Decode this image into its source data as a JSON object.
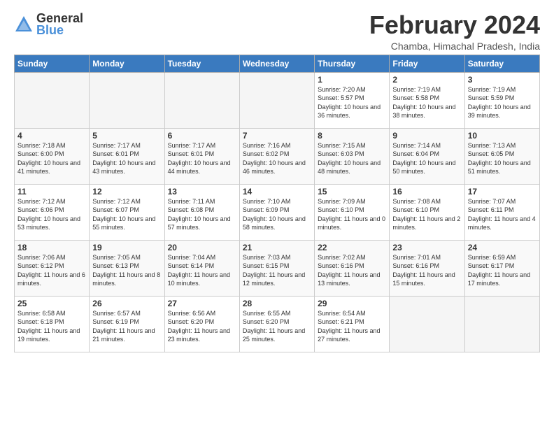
{
  "logo": {
    "general": "General",
    "blue": "Blue"
  },
  "title": "February 2024",
  "location": "Chamba, Himachal Pradesh, India",
  "headers": [
    "Sunday",
    "Monday",
    "Tuesday",
    "Wednesday",
    "Thursday",
    "Friday",
    "Saturday"
  ],
  "weeks": [
    [
      {
        "day": "",
        "sunrise": "",
        "sunset": "",
        "daylight": ""
      },
      {
        "day": "",
        "sunrise": "",
        "sunset": "",
        "daylight": ""
      },
      {
        "day": "",
        "sunrise": "",
        "sunset": "",
        "daylight": ""
      },
      {
        "day": "",
        "sunrise": "",
        "sunset": "",
        "daylight": ""
      },
      {
        "day": "1",
        "sunrise": "Sunrise: 7:20 AM",
        "sunset": "Sunset: 5:57 PM",
        "daylight": "Daylight: 10 hours and 36 minutes."
      },
      {
        "day": "2",
        "sunrise": "Sunrise: 7:19 AM",
        "sunset": "Sunset: 5:58 PM",
        "daylight": "Daylight: 10 hours and 38 minutes."
      },
      {
        "day": "3",
        "sunrise": "Sunrise: 7:19 AM",
        "sunset": "Sunset: 5:59 PM",
        "daylight": "Daylight: 10 hours and 39 minutes."
      }
    ],
    [
      {
        "day": "4",
        "sunrise": "Sunrise: 7:18 AM",
        "sunset": "Sunset: 6:00 PM",
        "daylight": "Daylight: 10 hours and 41 minutes."
      },
      {
        "day": "5",
        "sunrise": "Sunrise: 7:17 AM",
        "sunset": "Sunset: 6:01 PM",
        "daylight": "Daylight: 10 hours and 43 minutes."
      },
      {
        "day": "6",
        "sunrise": "Sunrise: 7:17 AM",
        "sunset": "Sunset: 6:01 PM",
        "daylight": "Daylight: 10 hours and 44 minutes."
      },
      {
        "day": "7",
        "sunrise": "Sunrise: 7:16 AM",
        "sunset": "Sunset: 6:02 PM",
        "daylight": "Daylight: 10 hours and 46 minutes."
      },
      {
        "day": "8",
        "sunrise": "Sunrise: 7:15 AM",
        "sunset": "Sunset: 6:03 PM",
        "daylight": "Daylight: 10 hours and 48 minutes."
      },
      {
        "day": "9",
        "sunrise": "Sunrise: 7:14 AM",
        "sunset": "Sunset: 6:04 PM",
        "daylight": "Daylight: 10 hours and 50 minutes."
      },
      {
        "day": "10",
        "sunrise": "Sunrise: 7:13 AM",
        "sunset": "Sunset: 6:05 PM",
        "daylight": "Daylight: 10 hours and 51 minutes."
      }
    ],
    [
      {
        "day": "11",
        "sunrise": "Sunrise: 7:12 AM",
        "sunset": "Sunset: 6:06 PM",
        "daylight": "Daylight: 10 hours and 53 minutes."
      },
      {
        "day": "12",
        "sunrise": "Sunrise: 7:12 AM",
        "sunset": "Sunset: 6:07 PM",
        "daylight": "Daylight: 10 hours and 55 minutes."
      },
      {
        "day": "13",
        "sunrise": "Sunrise: 7:11 AM",
        "sunset": "Sunset: 6:08 PM",
        "daylight": "Daylight: 10 hours and 57 minutes."
      },
      {
        "day": "14",
        "sunrise": "Sunrise: 7:10 AM",
        "sunset": "Sunset: 6:09 PM",
        "daylight": "Daylight: 10 hours and 58 minutes."
      },
      {
        "day": "15",
        "sunrise": "Sunrise: 7:09 AM",
        "sunset": "Sunset: 6:10 PM",
        "daylight": "Daylight: 11 hours and 0 minutes."
      },
      {
        "day": "16",
        "sunrise": "Sunrise: 7:08 AM",
        "sunset": "Sunset: 6:10 PM",
        "daylight": "Daylight: 11 hours and 2 minutes."
      },
      {
        "day": "17",
        "sunrise": "Sunrise: 7:07 AM",
        "sunset": "Sunset: 6:11 PM",
        "daylight": "Daylight: 11 hours and 4 minutes."
      }
    ],
    [
      {
        "day": "18",
        "sunrise": "Sunrise: 7:06 AM",
        "sunset": "Sunset: 6:12 PM",
        "daylight": "Daylight: 11 hours and 6 minutes."
      },
      {
        "day": "19",
        "sunrise": "Sunrise: 7:05 AM",
        "sunset": "Sunset: 6:13 PM",
        "daylight": "Daylight: 11 hours and 8 minutes."
      },
      {
        "day": "20",
        "sunrise": "Sunrise: 7:04 AM",
        "sunset": "Sunset: 6:14 PM",
        "daylight": "Daylight: 11 hours and 10 minutes."
      },
      {
        "day": "21",
        "sunrise": "Sunrise: 7:03 AM",
        "sunset": "Sunset: 6:15 PM",
        "daylight": "Daylight: 11 hours and 12 minutes."
      },
      {
        "day": "22",
        "sunrise": "Sunrise: 7:02 AM",
        "sunset": "Sunset: 6:16 PM",
        "daylight": "Daylight: 11 hours and 13 minutes."
      },
      {
        "day": "23",
        "sunrise": "Sunrise: 7:01 AM",
        "sunset": "Sunset: 6:16 PM",
        "daylight": "Daylight: 11 hours and 15 minutes."
      },
      {
        "day": "24",
        "sunrise": "Sunrise: 6:59 AM",
        "sunset": "Sunset: 6:17 PM",
        "daylight": "Daylight: 11 hours and 17 minutes."
      }
    ],
    [
      {
        "day": "25",
        "sunrise": "Sunrise: 6:58 AM",
        "sunset": "Sunset: 6:18 PM",
        "daylight": "Daylight: 11 hours and 19 minutes."
      },
      {
        "day": "26",
        "sunrise": "Sunrise: 6:57 AM",
        "sunset": "Sunset: 6:19 PM",
        "daylight": "Daylight: 11 hours and 21 minutes."
      },
      {
        "day": "27",
        "sunrise": "Sunrise: 6:56 AM",
        "sunset": "Sunset: 6:20 PM",
        "daylight": "Daylight: 11 hours and 23 minutes."
      },
      {
        "day": "28",
        "sunrise": "Sunrise: 6:55 AM",
        "sunset": "Sunset: 6:20 PM",
        "daylight": "Daylight: 11 hours and 25 minutes."
      },
      {
        "day": "29",
        "sunrise": "Sunrise: 6:54 AM",
        "sunset": "Sunset: 6:21 PM",
        "daylight": "Daylight: 11 hours and 27 minutes."
      },
      {
        "day": "",
        "sunrise": "",
        "sunset": "",
        "daylight": ""
      },
      {
        "day": "",
        "sunrise": "",
        "sunset": "",
        "daylight": ""
      }
    ]
  ]
}
